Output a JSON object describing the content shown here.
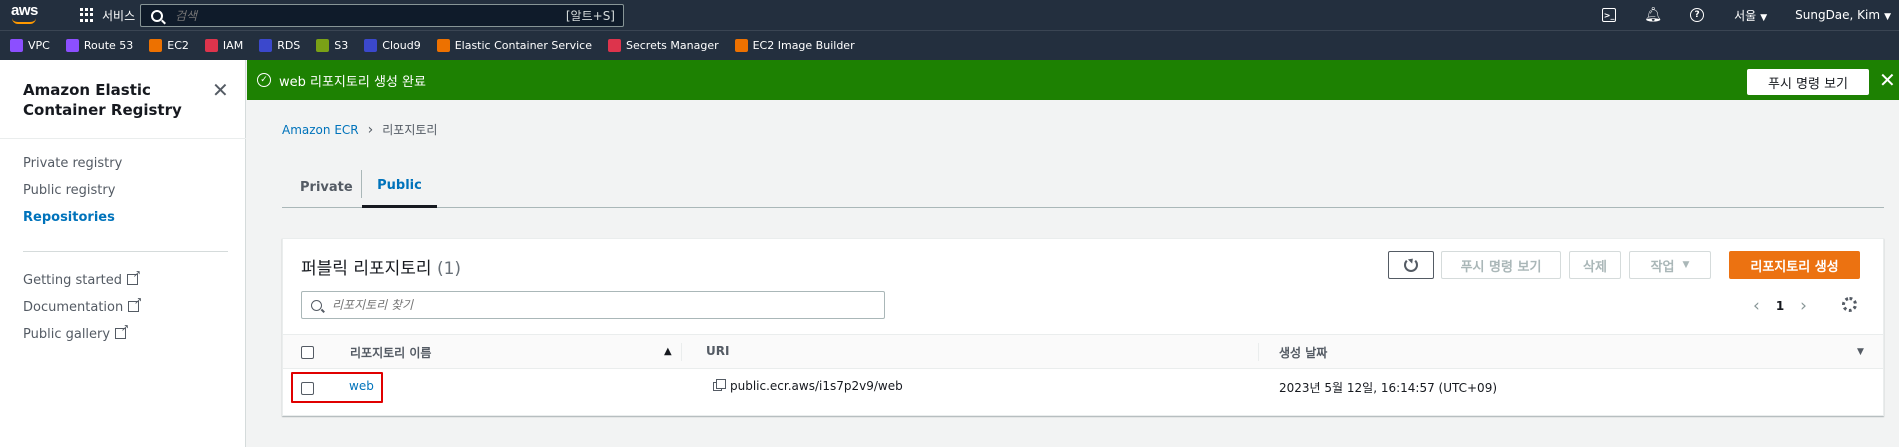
{
  "topnav": {
    "logo": "aws",
    "services_label": "서비스",
    "search_placeholder": "검색",
    "search_shortcut": "[알트+S]",
    "region": "서울",
    "user": "SungDae, Kim"
  },
  "favorites": [
    {
      "label": "VPC",
      "color": "#8c4fff"
    },
    {
      "label": "Route 53",
      "color": "#8c4fff"
    },
    {
      "label": "EC2",
      "color": "#ed7100"
    },
    {
      "label": "IAM",
      "color": "#dd344c"
    },
    {
      "label": "RDS",
      "color": "#3b48cc"
    },
    {
      "label": "S3",
      "color": "#7aa116"
    },
    {
      "label": "Cloud9",
      "color": "#3b48cc"
    },
    {
      "label": "Elastic Container Service",
      "color": "#ed7100"
    },
    {
      "label": "Secrets Manager",
      "color": "#dd344c"
    },
    {
      "label": "EC2 Image Builder",
      "color": "#ed7100"
    }
  ],
  "sidenav": {
    "title": "Amazon Elastic Container Registry",
    "items": [
      {
        "label": "Private registry"
      },
      {
        "label": "Public registry"
      },
      {
        "label": "Repositories"
      }
    ],
    "external": [
      {
        "label": "Getting started"
      },
      {
        "label": "Documentation"
      },
      {
        "label": "Public gallery"
      }
    ]
  },
  "flash": {
    "message": "web 리포지토리 생성 완료",
    "button": "푸시 명령 보기"
  },
  "breadcrumb": {
    "root": "Amazon ECR",
    "current": "리포지토리"
  },
  "tabs": {
    "private": "Private",
    "public": "Public"
  },
  "panel": {
    "title": "퍼블릭 리포지토리",
    "count": "(1)",
    "push_button": "푸시 명령 보기",
    "delete_button": "삭제",
    "action_button": "작업",
    "create_button": "리포지토리 생성",
    "filter_placeholder": "리포지토리 찾기",
    "page": "1"
  },
  "table": {
    "headers": {
      "name": "리포지토리 이름",
      "uri": "URI",
      "created": "생성 날짜"
    },
    "rows": [
      {
        "name": "web",
        "uri": "public.ecr.aws/i1s7p2v9/web",
        "created": "2023년 5월 12일, 16:14:57 (UTC+09)"
      }
    ]
  },
  "colors": {
    "nav_bg": "#232f3e",
    "success": "#1d8102",
    "link": "#0073bb",
    "primary_button": "#ec7211",
    "highlight": "#e00000"
  }
}
